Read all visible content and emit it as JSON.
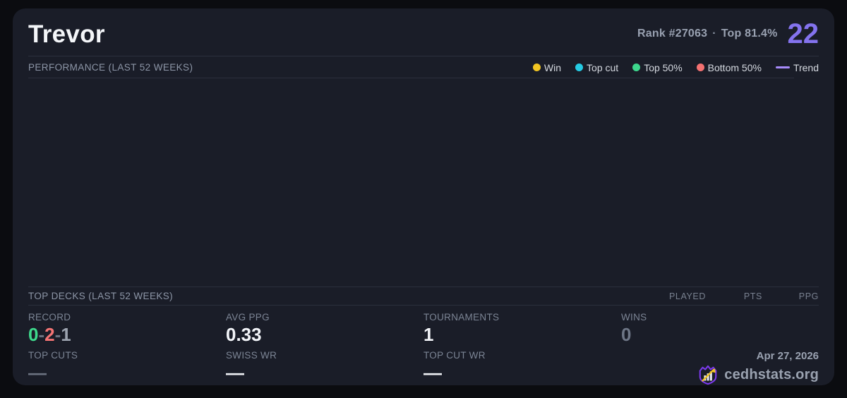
{
  "player": {
    "name": "Trevor",
    "rank_label": "Rank #27063",
    "separator": "·",
    "top_percent": "Top 81.4%",
    "score": "22"
  },
  "performance": {
    "title": "PERFORMANCE (LAST 52 WEEKS)",
    "legend": [
      {
        "label": "Win",
        "color": "#f2c522",
        "marker": "dot"
      },
      {
        "label": "Top cut",
        "color": "#25cbe3",
        "marker": "dot"
      },
      {
        "label": "Top 50%",
        "color": "#3dd68c",
        "marker": "dot"
      },
      {
        "label": "Bottom 50%",
        "color": "#f47171",
        "marker": "dot"
      },
      {
        "label": "Trend",
        "color": "#a78bfa",
        "marker": "line"
      }
    ],
    "chart": {
      "type": "scatter",
      "points": []
    }
  },
  "top_decks": {
    "title": "TOP DECKS (LAST 52 WEEKS)",
    "columns": [
      "PLAYED",
      "PTS",
      "PPG"
    ],
    "rows": []
  },
  "stats": {
    "record": {
      "label": "RECORD",
      "wins": "0",
      "losses": "2",
      "draws": "1",
      "separator": "-"
    },
    "avg_ppg": {
      "label": "AVG PPG",
      "value": "0.33"
    },
    "tournaments": {
      "label": "TOURNAMENTS",
      "value": "1"
    },
    "wins": {
      "label": "WINS",
      "value": "0"
    },
    "top_cuts": {
      "label": "TOP CUTS",
      "value": "—"
    },
    "swiss_wr": {
      "label": "SWISS WR",
      "value": "—"
    },
    "top_cut_wr": {
      "label": "TOP CUT WR",
      "value": "—"
    }
  },
  "footer": {
    "date": "Apr 27, 2026",
    "brand": "cedhstats.org"
  },
  "colors": {
    "accent_purple": "#8473ee",
    "win_green": "#3ed98c",
    "loss_red": "#f47474",
    "draw_gray": "#9ca3af",
    "card_bg": "#1a1d28",
    "page_bg": "#0b0c10",
    "divider": "#2b303d",
    "logo_purple": "#7c3aed",
    "logo_gold": "#f2c522"
  }
}
